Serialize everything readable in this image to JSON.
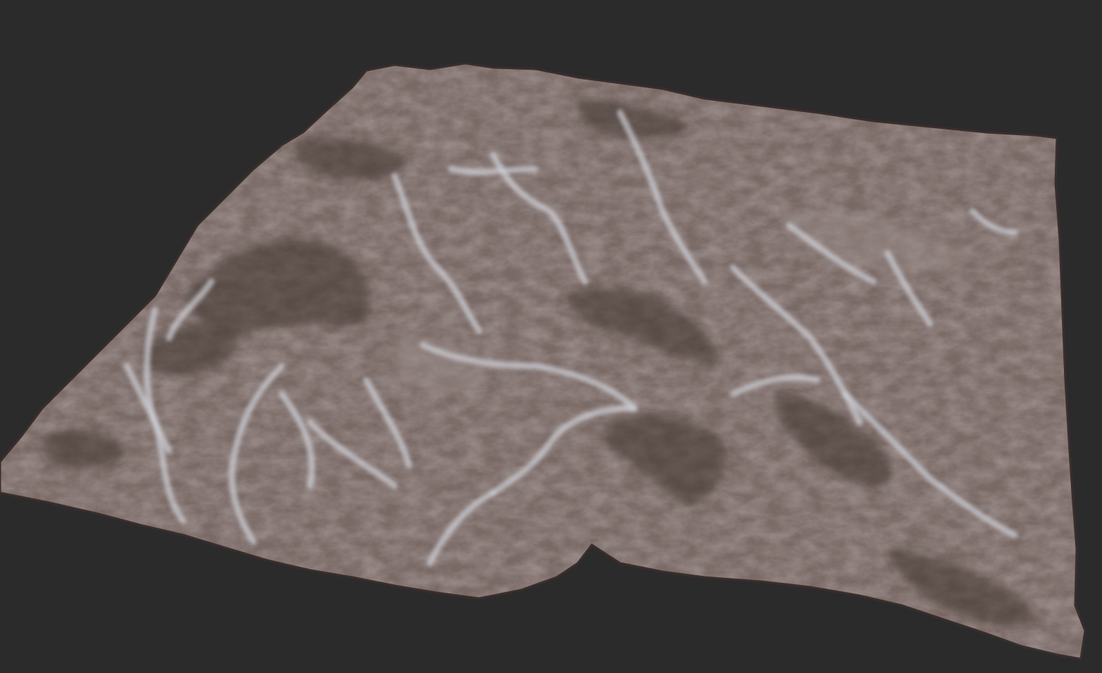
{
  "scene": {
    "background_color": "#2b2b2b",
    "subject": "terrain-mesh",
    "terrain": {
      "base_color": "#7a6a66",
      "shadow_color": "#3a2e2c",
      "highlight_color": "#9c8e8a",
      "riverbed_color": "#d8dde6"
    }
  }
}
